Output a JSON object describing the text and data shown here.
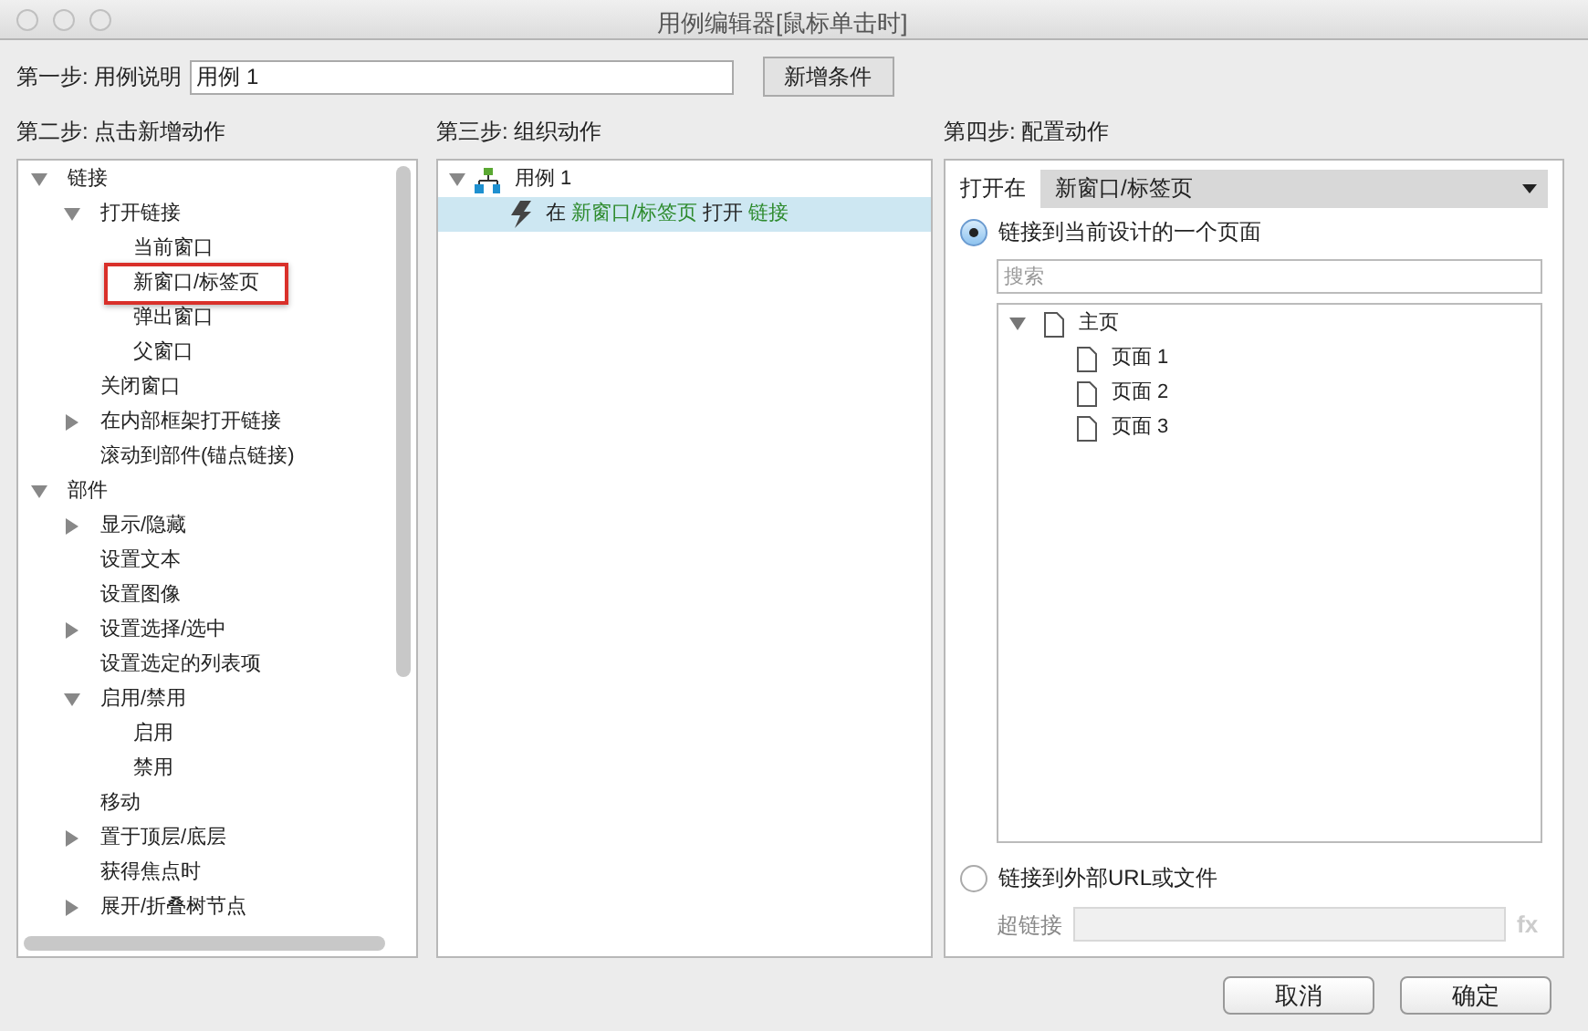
{
  "window": {
    "title": "用例编辑器[鼠标单击时]"
  },
  "step1": {
    "label": "第一步: 用例说明",
    "value": "用例 1",
    "button": "新增条件"
  },
  "step2": {
    "label": "第二步: 点击新增动作",
    "tree": [
      {
        "label": "链接",
        "expanded": true,
        "children": [
          {
            "label": "打开链接",
            "expanded": true,
            "children": [
              {
                "label": "当前窗口",
                "highlighted": false
              },
              {
                "label": "新窗口/标签页",
                "highlighted": true
              },
              {
                "label": "弹出窗口",
                "highlighted": false
              },
              {
                "label": "父窗口",
                "highlighted": false
              }
            ]
          },
          {
            "label": "关闭窗口"
          },
          {
            "label": "在内部框架打开链接",
            "expanded": false
          },
          {
            "label": "滚动到部件(锚点链接)"
          }
        ]
      },
      {
        "label": "部件",
        "expanded": true,
        "children": [
          {
            "label": "显示/隐藏",
            "expanded": false
          },
          {
            "label": "设置文本"
          },
          {
            "label": "设置图像"
          },
          {
            "label": "设置选择/选中",
            "expanded": false
          },
          {
            "label": "设置选定的列表项"
          },
          {
            "label": "启用/禁用",
            "expanded": true,
            "children": [
              {
                "label": "启用"
              },
              {
                "label": "禁用"
              }
            ]
          },
          {
            "label": "移动"
          },
          {
            "label": "置于顶层/底层",
            "expanded": false
          },
          {
            "label": "获得焦点时"
          },
          {
            "label": "展开/折叠树节点",
            "expanded": false
          }
        ]
      }
    ]
  },
  "step3": {
    "label": "第三步: 组织动作",
    "case": {
      "label": "用例 1",
      "expanded": true,
      "actions": [
        {
          "selected": true,
          "parts": [
            {
              "kind": "plain",
              "text": "在"
            },
            {
              "kind": "value",
              "text": "新窗口/标签页"
            },
            {
              "kind": "plain",
              "text": "打开"
            },
            {
              "kind": "value",
              "text": "链接"
            }
          ]
        }
      ]
    }
  },
  "step4": {
    "label": "第四步: 配置动作",
    "open_in": {
      "label": "打开在",
      "value": "新窗口/标签页"
    },
    "options": [
      {
        "kind": "page",
        "label": "链接到当前设计的一个页面",
        "selected": true,
        "search_placeholder": "搜索",
        "pages": [
          {
            "label": "主页",
            "expanded": true,
            "children": [
              {
                "label": "页面 1"
              },
              {
                "label": "页面 2"
              },
              {
                "label": "页面 3"
              }
            ]
          }
        ]
      },
      {
        "kind": "url",
        "label": "链接到外部URL或文件",
        "selected": false,
        "field_label": "超链接",
        "fx": "fx"
      }
    ]
  },
  "buttons": [
    {
      "label": "取消"
    },
    {
      "label": "确定"
    }
  ]
}
